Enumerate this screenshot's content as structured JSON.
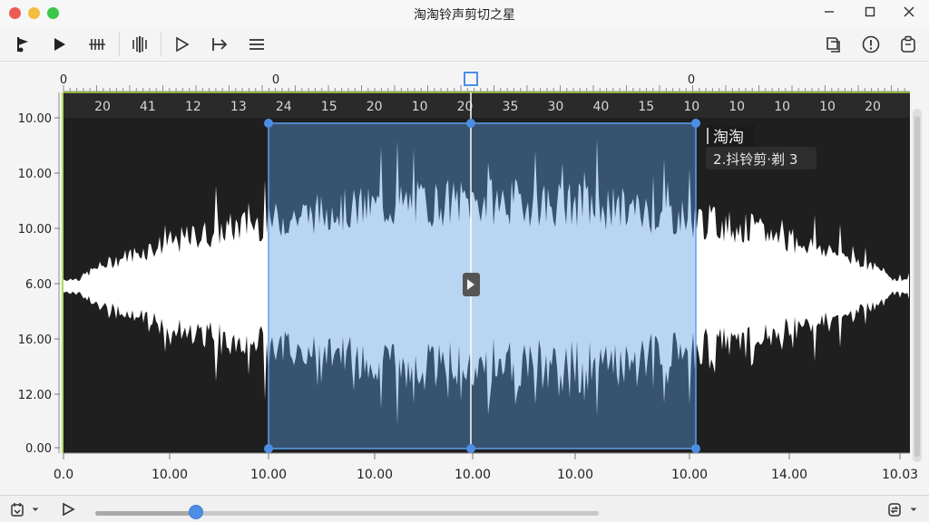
{
  "window": {
    "title": "淘淘铃声剪切之星"
  },
  "colors": {
    "accent": "#4c8ee6",
    "waveform": "#ffffff",
    "selection": "#2b4f77",
    "background": "#1f1f1f"
  },
  "toolbar": {
    "left_icons": [
      "flag-icon",
      "play-icon",
      "split-icon",
      "cut-icon",
      "play-outline-icon",
      "jump-to-icon",
      "menu-icon"
    ],
    "right_icons": [
      "copy-icon",
      "info-icon",
      "clipboard-icon"
    ]
  },
  "ruler": {
    "top_labels": [
      "0",
      "0",
      "0"
    ],
    "inner_labels": [
      "20",
      "41",
      "12",
      "13",
      "24",
      "15",
      "20",
      "10",
      "20",
      "35",
      "30",
      "40",
      "15",
      "10",
      "10",
      "10",
      "10",
      "20"
    ]
  },
  "y_axis": {
    "labels": [
      "10.00",
      "10.00",
      "10.00",
      "6.00",
      "16.00",
      "12.00",
      "0.00"
    ]
  },
  "x_axis": {
    "labels": [
      "0.0",
      "10.00",
      "10.00",
      "10.00",
      "10.00",
      "10.00",
      "10.00",
      "14.00",
      "10.03"
    ]
  },
  "selection": {
    "start_fraction": 0.245,
    "end_fraction": 0.755,
    "playhead_fraction": 0.5
  },
  "clip_label": {
    "title": "淘淘",
    "subtitle": "2.抖铃剪·剃 3"
  },
  "player": {
    "progress": 0.2
  },
  "bottom": {
    "left_icons": [
      "export-icon",
      "chevron-down-icon",
      "play-outline-icon"
    ],
    "right_icons": [
      "loop-icon",
      "chevron-down-icon"
    ]
  }
}
